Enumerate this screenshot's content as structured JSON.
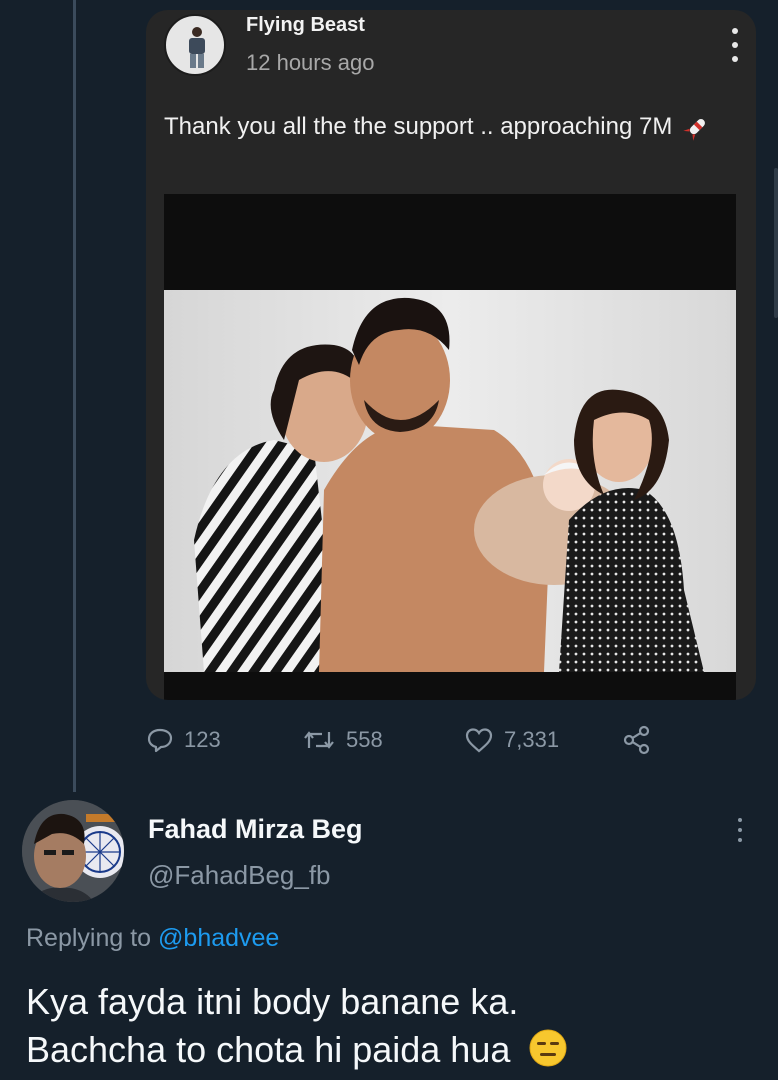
{
  "original_post": {
    "author_name": "Flying Beast",
    "time_ago": "12 hours ago",
    "text": "Thank you all the the support .. approaching 7M",
    "avatar_icon": "profile-avatar-icon",
    "menu_icon": "more-vertical-icon",
    "trailing_icon": "rocket-icon"
  },
  "actions": {
    "replies": "123",
    "retweets": "558",
    "likes": "7,331",
    "icons": [
      "reply-icon",
      "retweet-icon",
      "like-icon",
      "share-icon"
    ]
  },
  "reply": {
    "author_name": "Fahad Mirza Beg",
    "handle": "@FahadBeg_fb",
    "replying_prefix": "Replying to",
    "replying_to": "@bhadvee",
    "text_line1": "Kya fayda itni body banane ka.",
    "text_line2": "Bachcha to chota hi paida hua",
    "trailing_icon": "expressionless-face-icon"
  },
  "colors": {
    "background": "#15202b",
    "card": "#262626",
    "accent": "#1d9bf0",
    "muted": "#8b98a5"
  }
}
